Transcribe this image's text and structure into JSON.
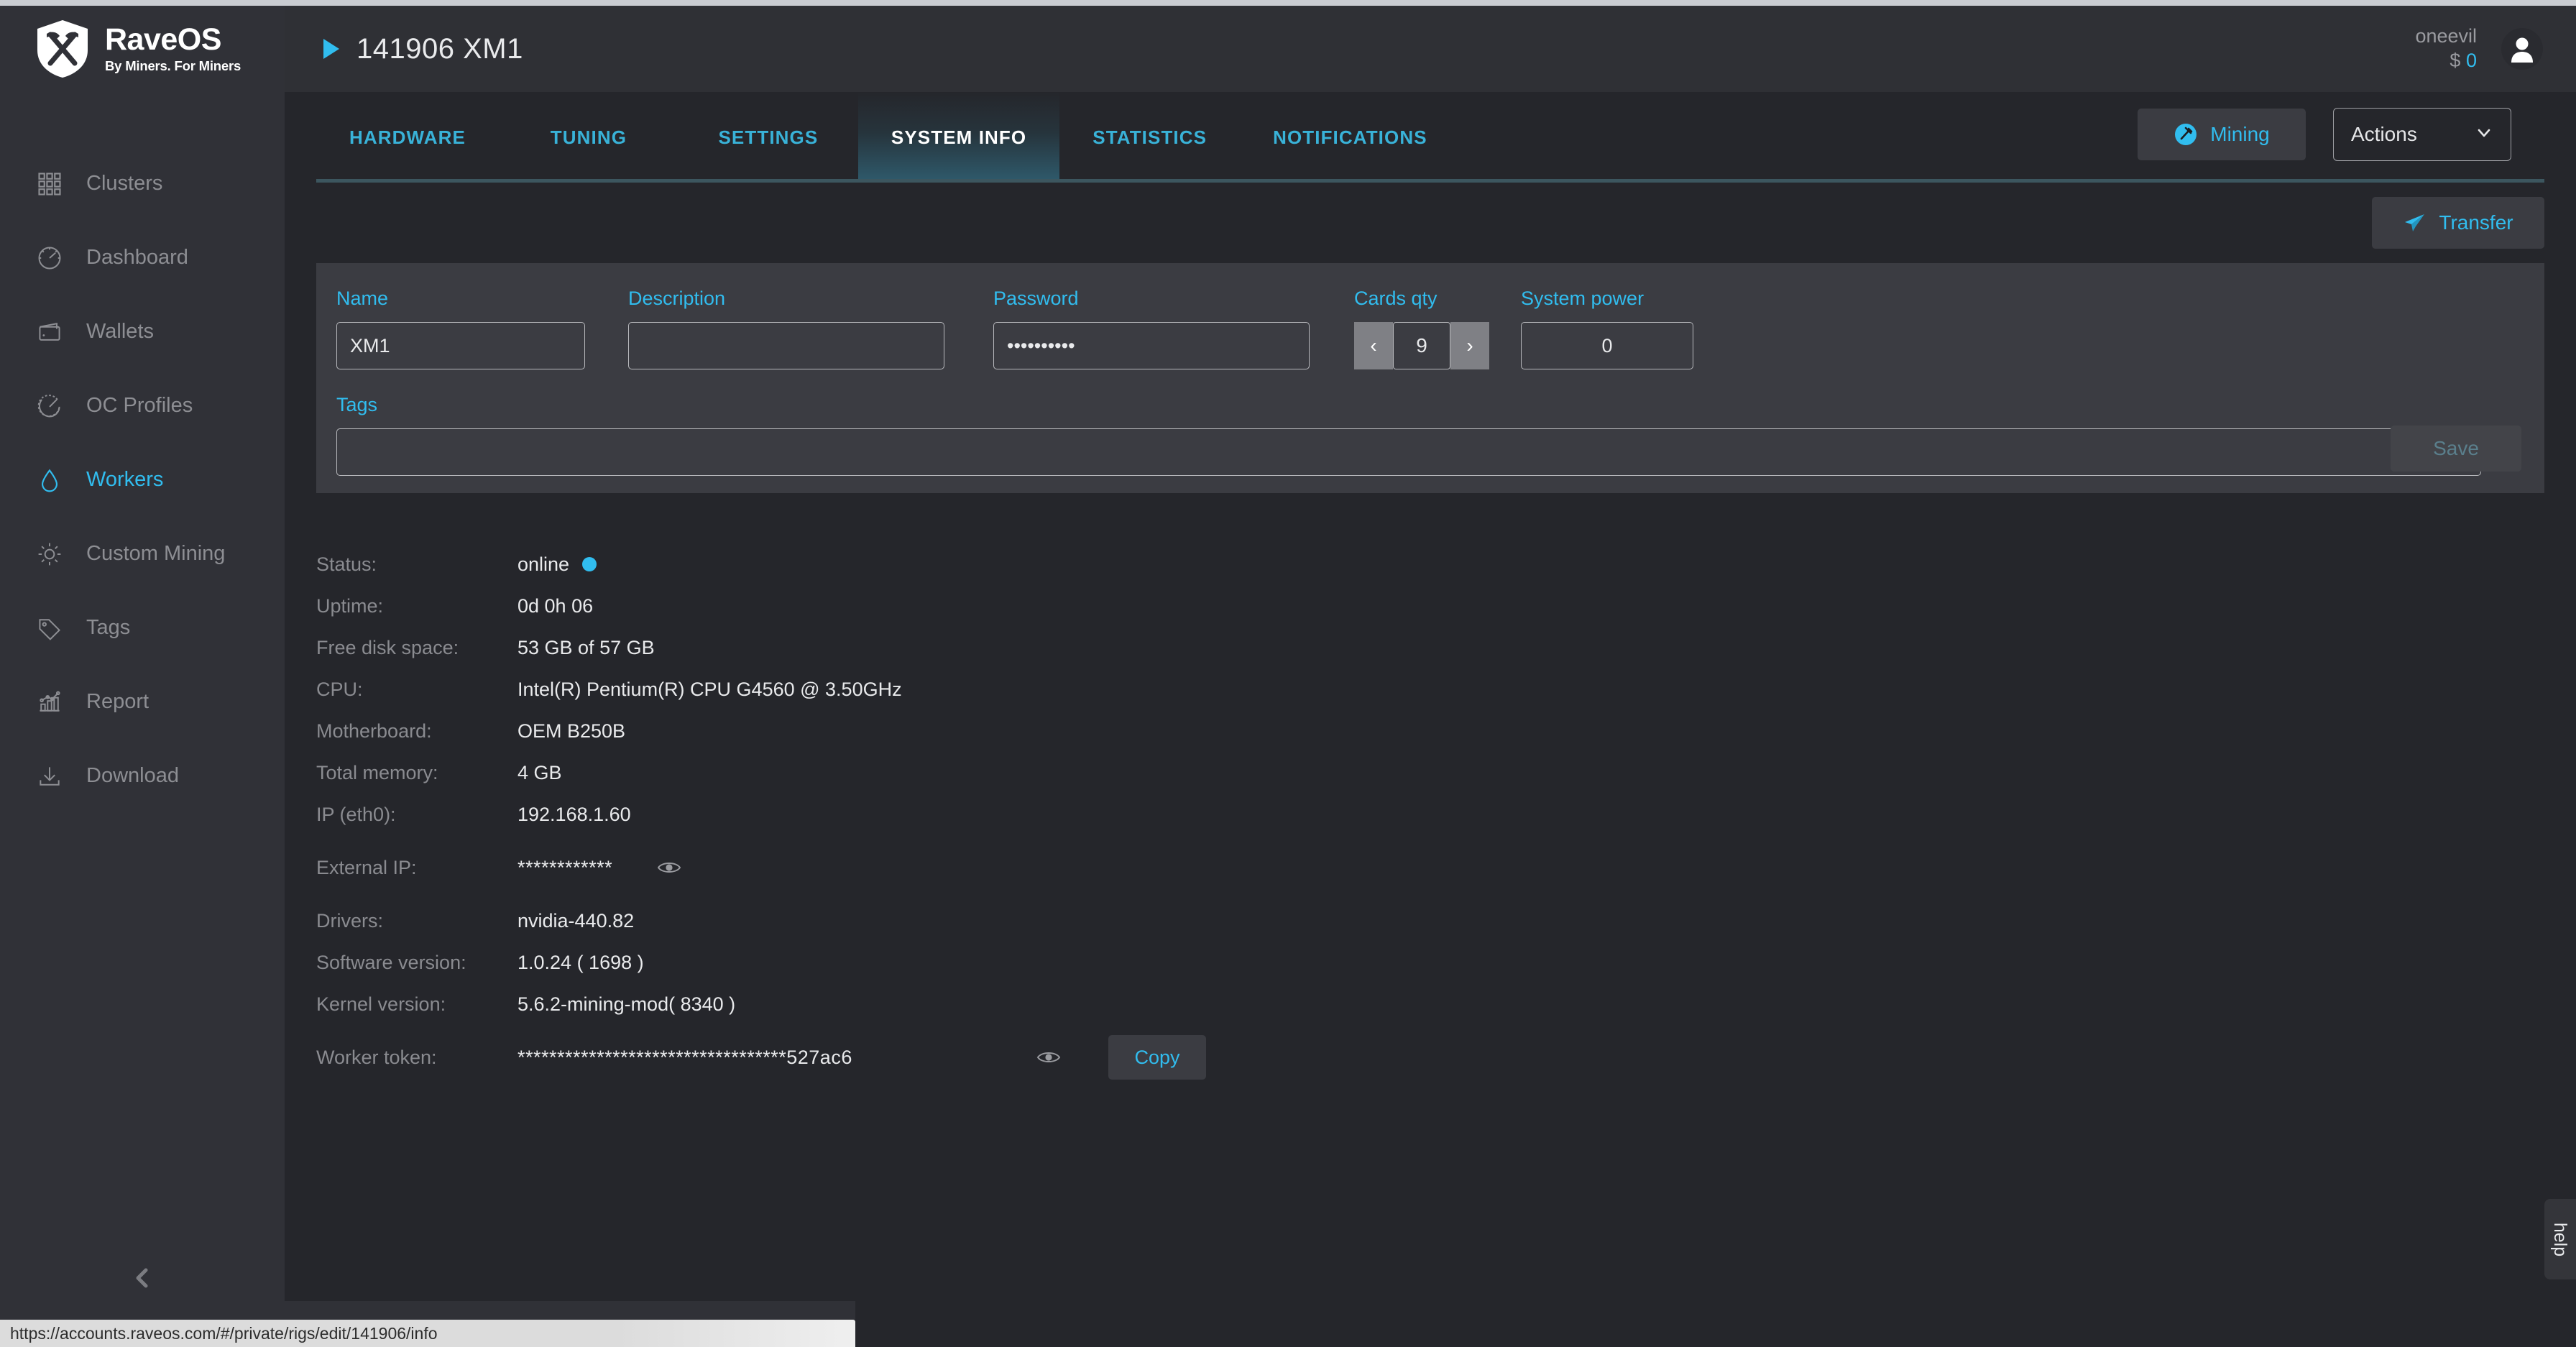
{
  "brand": {
    "logo_icon": "raveos-shield-pickaxe-logo",
    "name": "RaveOS",
    "tagline": "By Miners. For Miners",
    "accent_color": "#31bdef"
  },
  "sidebar": {
    "items": [
      {
        "label": "Clusters",
        "icon": "grid-icon",
        "active": false
      },
      {
        "label": "Dashboard",
        "icon": "gauge-icon",
        "active": false
      },
      {
        "label": "Wallets",
        "icon": "wallet-icon",
        "active": false
      },
      {
        "label": "OC Profiles",
        "icon": "speedometer-icon",
        "active": false
      },
      {
        "label": "Workers",
        "icon": "droplet-icon",
        "active": true
      },
      {
        "label": "Custom Mining",
        "icon": "gear-icon",
        "active": false
      },
      {
        "label": "Tags",
        "icon": "tag-icon",
        "active": false
      },
      {
        "label": "Report",
        "icon": "chart-icon",
        "active": false
      },
      {
        "label": "Download",
        "icon": "download-icon",
        "active": false
      }
    ],
    "collapse_icon": "chevron-left-icon"
  },
  "header": {
    "status_icon": "play-triangle-icon",
    "title": "141906 XM1",
    "user_name": "oneevil",
    "balance_currency": "$",
    "balance_value": "0",
    "avatar_icon": "user-avatar-icon"
  },
  "tabs": [
    {
      "label": "HARDWARE",
      "active": false
    },
    {
      "label": "TUNING",
      "active": false
    },
    {
      "label": "SETTINGS",
      "active": false
    },
    {
      "label": "SYSTEM INFO",
      "active": true
    },
    {
      "label": "STATISTICS",
      "active": false
    },
    {
      "label": "NOTIFICATIONS",
      "active": false
    }
  ],
  "top_actions": {
    "mining_label": "Mining",
    "mining_icon": "pickaxe-circle-icon",
    "actions_label": "Actions",
    "actions_chevron_icon": "chevron-down-icon"
  },
  "transfer": {
    "label": "Transfer",
    "icon": "paper-plane-icon"
  },
  "form": {
    "name": {
      "label": "Name",
      "value": "XM1",
      "placeholder": ""
    },
    "description": {
      "label": "Description",
      "value": "",
      "placeholder": ""
    },
    "password": {
      "label": "Password",
      "value": "..........",
      "placeholder": ""
    },
    "cards_qty": {
      "label": "Cards qty",
      "value": "9",
      "dec_icon": "chevron-left-icon",
      "inc_icon": "chevron-right-icon"
    },
    "system_power": {
      "label": "System power",
      "value": "0",
      "placeholder": ""
    },
    "save_label": "Save",
    "tags": {
      "label": "Tags",
      "value": "",
      "placeholder": "",
      "chevron_icon": "chevron-down-icon",
      "clear_icon": "close-circle-icon"
    }
  },
  "system_info": {
    "rows": [
      {
        "key": "Status:",
        "value": "online",
        "badge": "online-dot"
      },
      {
        "key": "Uptime:",
        "value": "0d 0h 06"
      },
      {
        "key": "Free disk space:",
        "value": "53 GB of 57 GB"
      },
      {
        "key": "CPU:",
        "value": "Intel(R) Pentium(R) CPU G4560 @ 3.50GHz"
      },
      {
        "key": "Motherboard:",
        "value": "OEM B250B"
      },
      {
        "key": "Total memory:",
        "value": "4 GB"
      },
      {
        "key": "IP (eth0):",
        "value": "192.168.1.60"
      },
      {
        "key": "External IP:",
        "value": "************",
        "reveal_icon": "eye-icon"
      },
      {
        "key": "Drivers:",
        "value": "nvidia-440.82"
      },
      {
        "key": "Software version:",
        "value": "1.0.24 ( 1698 )"
      },
      {
        "key": "Kernel version:",
        "value": "5.6.2-mining-mod( 8340 )"
      },
      {
        "key": "Worker token:",
        "value": "**********************************527ac6",
        "reveal_icon": "eye-icon",
        "copy_label": "Copy"
      }
    ]
  },
  "help": {
    "label": "help"
  },
  "statusbar": {
    "url": "https://accounts.raveos.com/#/private/rigs/edit/141906/info"
  }
}
